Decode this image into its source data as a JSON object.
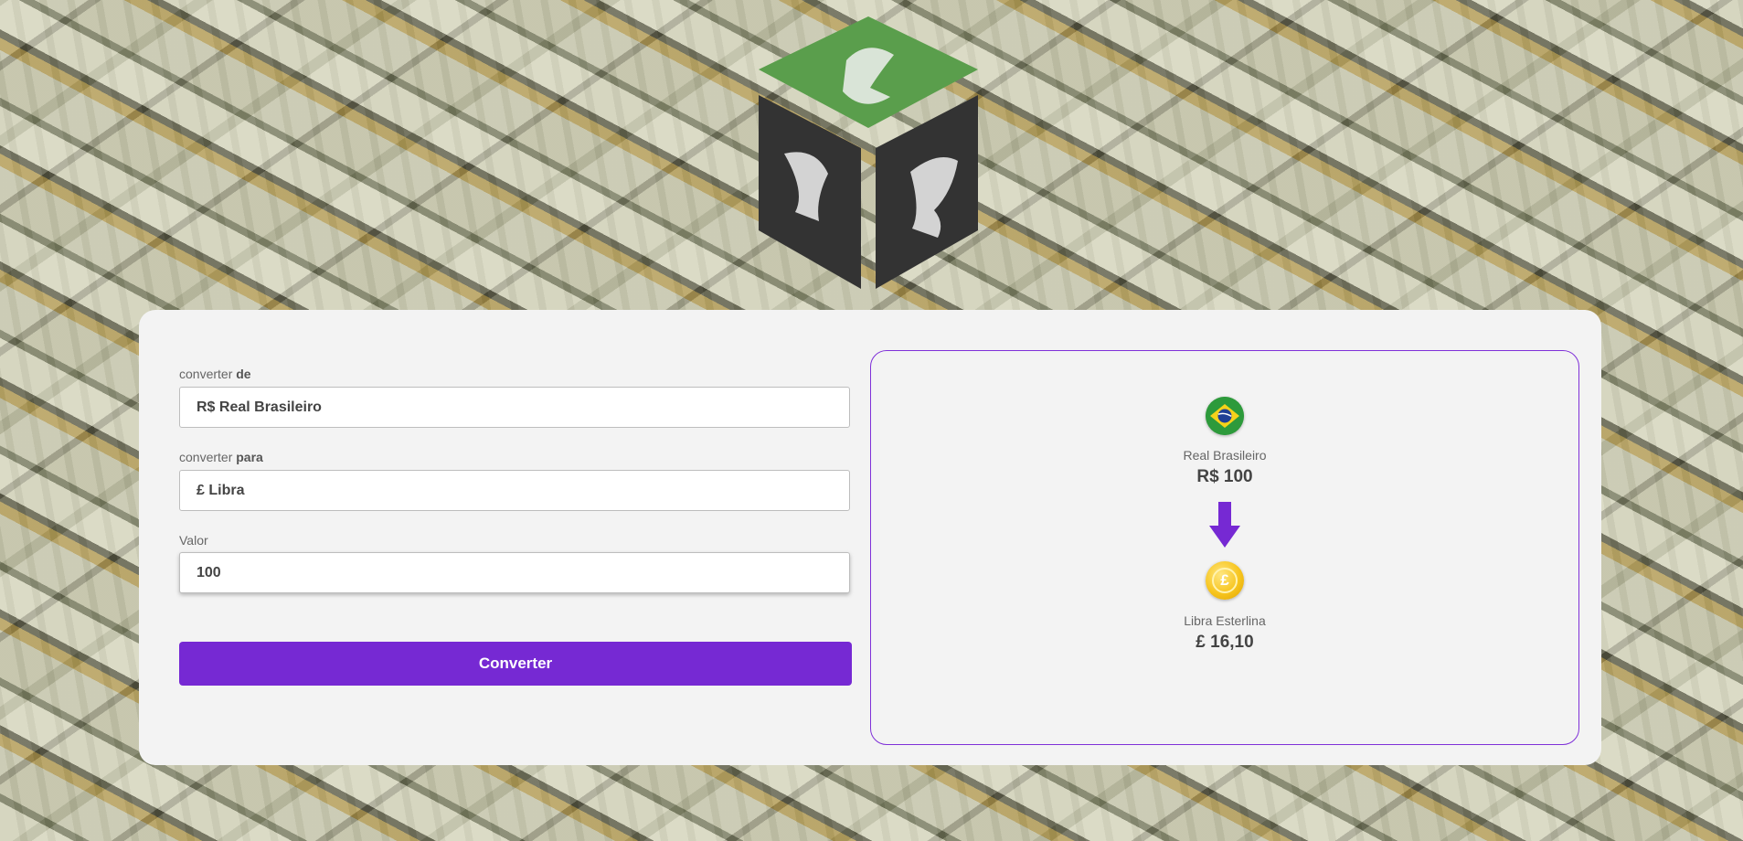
{
  "form": {
    "from_label_prefix": "converter",
    "from_label_bold": "de",
    "from_value": "R$ Real Brasileiro",
    "to_label_prefix": "converter",
    "to_label_bold": "para",
    "to_value": "£ Libra",
    "amount_label": "Valor",
    "amount_value": "100",
    "convert_button": "Converter"
  },
  "result": {
    "from_currency_name": "Real Brasileiro",
    "from_currency_value": "R$ 100",
    "to_currency_name": "Libra Esterlina",
    "to_currency_value": "£ 16,10",
    "to_coin_symbol": "£"
  },
  "colors": {
    "accent": "#7629d3",
    "logo_green": "#5a9e4c",
    "logo_dark": "#333333"
  },
  "icons": {
    "logo": "currency-cube-logo",
    "from_flag": "brazil-flag-icon",
    "to_coin": "pound-coin-icon",
    "arrow": "arrow-down-icon"
  }
}
